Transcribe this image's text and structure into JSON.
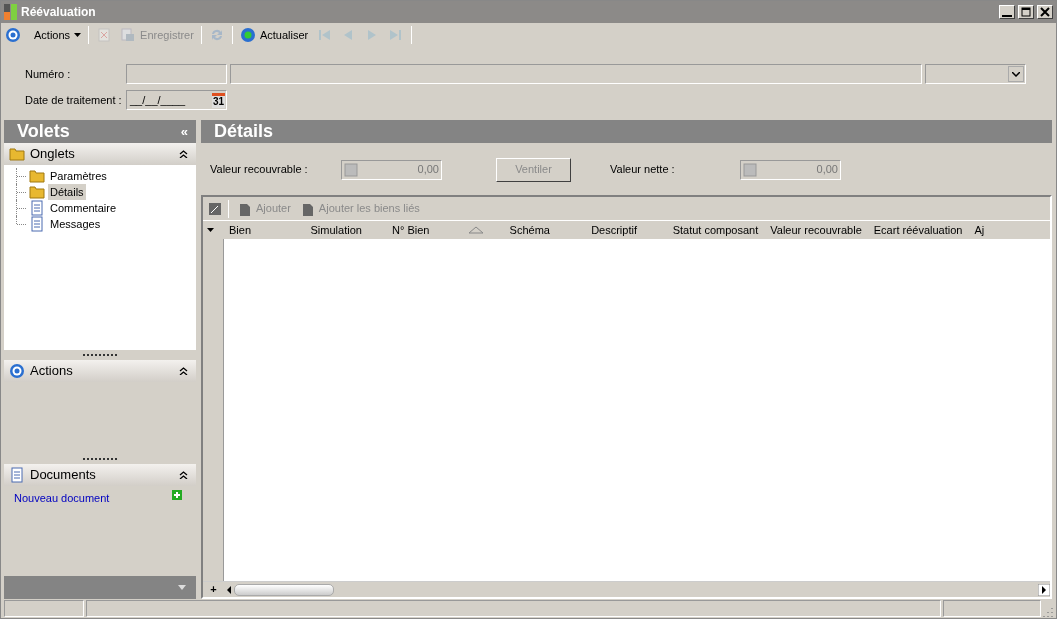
{
  "window": {
    "title": "Réévaluation"
  },
  "toolbar": [
    {
      "kind": "actions",
      "label": "Actions",
      "disabled": false
    },
    {
      "kind": "delete",
      "disabled": true
    },
    {
      "kind": "save",
      "label": "Enregistrer",
      "disabled": true
    },
    {
      "kind": "sync",
      "disabled": true
    },
    {
      "kind": "refresh",
      "label": "Actualiser",
      "disabled": false
    },
    {
      "kind": "first",
      "disabled": true
    },
    {
      "kind": "prev",
      "disabled": true
    },
    {
      "kind": "next",
      "disabled": true
    },
    {
      "kind": "last",
      "disabled": true
    }
  ],
  "form": {
    "numero_label": "Numéro :",
    "date_label": "Date de traitement :",
    "date_value": "__/__/____",
    "calendar_day": "31"
  },
  "sidebar": {
    "title": "Volets",
    "collapse": "«",
    "sections": [
      {
        "kind": "tree",
        "title": "Onglets",
        "expanded": true,
        "items": [
          {
            "kind": "folder",
            "label": "Paramètres",
            "selected": false
          },
          {
            "kind": "folder",
            "label": "Détails",
            "selected": true
          },
          {
            "kind": "doc",
            "label": "Commentaire",
            "selected": false
          },
          {
            "kind": "doc",
            "label": "Messages",
            "selected": false
          }
        ]
      },
      {
        "kind": "actions",
        "title": "Actions",
        "expanded": true
      },
      {
        "kind": "documents",
        "title": "Documents",
        "expanded": true,
        "link": "Nouveau document"
      }
    ]
  },
  "details": {
    "title": "Détails",
    "recoverable_label": "Valeur recouvrable :",
    "recoverable_value": "0,00",
    "split_button": {
      "label": "Ventiler",
      "disabled": true
    },
    "net_label": "Valeur nette :",
    "net_value": "0,00",
    "grid": {
      "add": {
        "label": "Ajouter",
        "disabled": true
      },
      "add_linked": {
        "label": "Ajouter les biens liés",
        "disabled": true
      },
      "columns": [
        {
          "label": "Bien"
        },
        {
          "label": "Simulation"
        },
        {
          "label": "N° Bien",
          "sorted": true
        },
        {
          "label": "Schéma"
        },
        {
          "label": "Descriptif"
        },
        {
          "label": "Statut composant"
        },
        {
          "label": "Valeur recouvrable"
        },
        {
          "label": "Ecart réévaluation"
        },
        {
          "label": "Aj"
        }
      ],
      "add_row": "+"
    }
  }
}
